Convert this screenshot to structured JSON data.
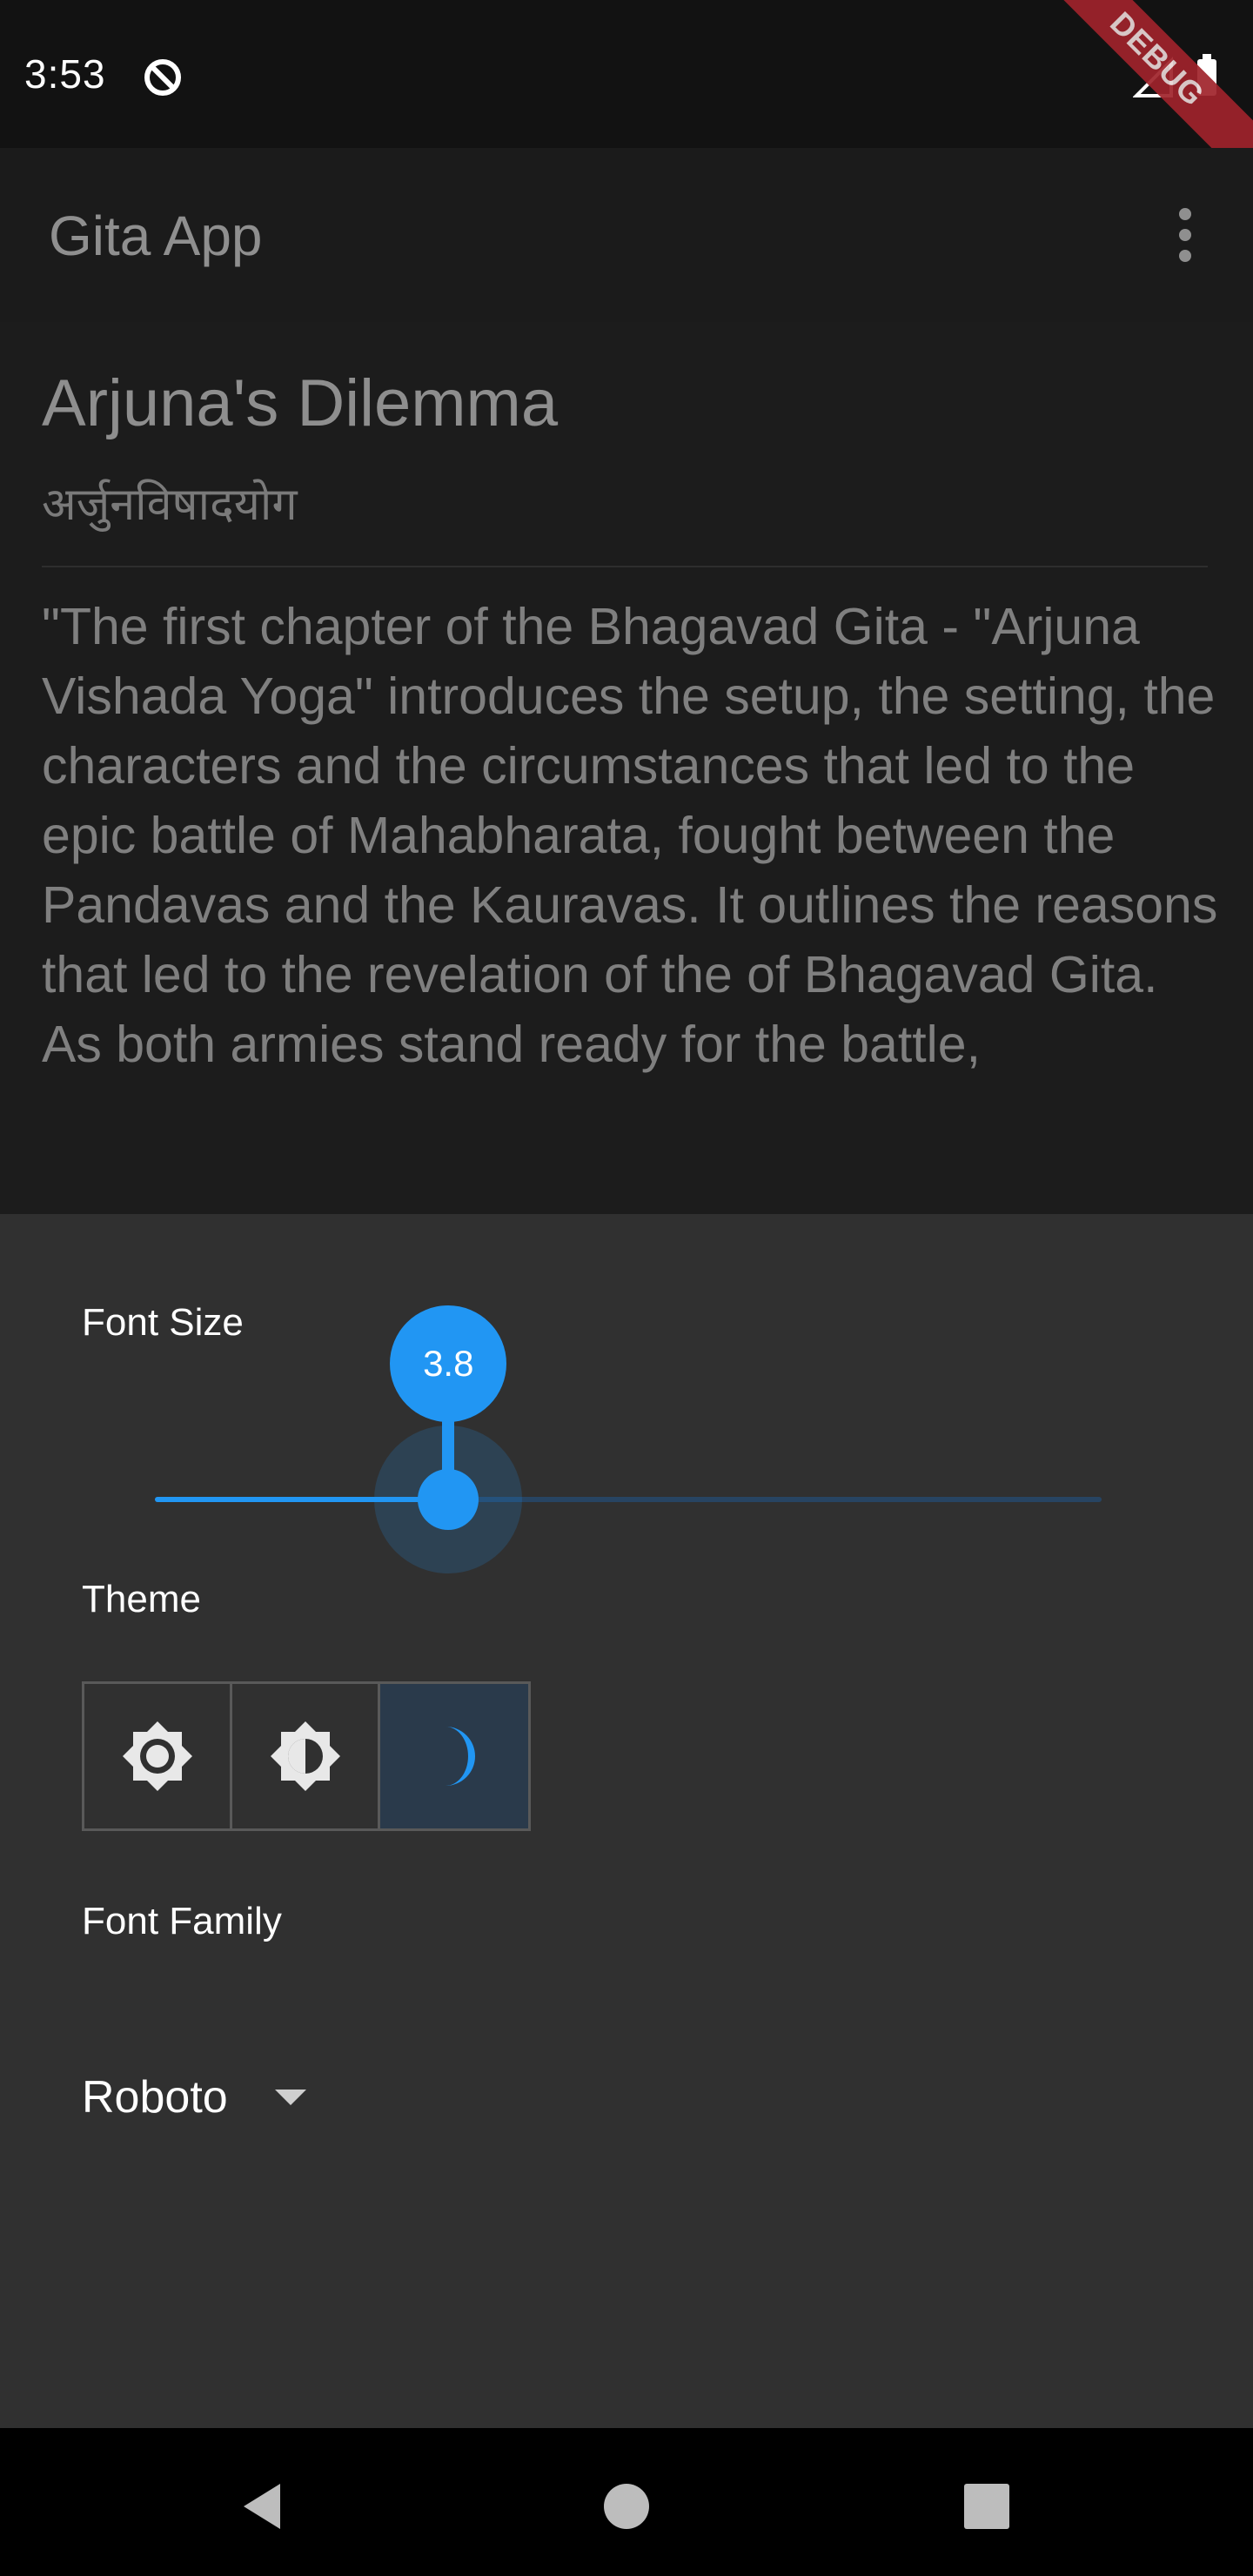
{
  "status_bar": {
    "time": "3:53",
    "debug_banner": "DEBUG",
    "icons": [
      "sync-icon",
      "signal-icon",
      "battery-icon"
    ]
  },
  "app_bar": {
    "title": "Gita App",
    "menu_icon": "more-vert-icon"
  },
  "chapter": {
    "title": "Arjuna's Dilemma",
    "subtitle": "अर्जुनविषादयोग",
    "body": "\"The first chapter of the Bhagavad Gita - \"Arjuna Vishada Yoga\" introduces the setup, the setting, the characters and the circumstances that led to the epic battle of Mahabharata, fought between the Pandavas and the Kauravas. It outlines the reasons that led to the revelation of the of Bhagavad Gita.\nAs both armies stand ready for the battle,"
  },
  "settings_sheet": {
    "font_size_label": "Font Size",
    "font_size_value": "3.8",
    "font_size_fraction": 0.31,
    "theme_label": "Theme",
    "theme_options": [
      {
        "icon": "light-mode-icon",
        "selected": false
      },
      {
        "icon": "auto-brightness-icon",
        "selected": false
      },
      {
        "icon": "dark-mode-icon",
        "selected": true
      }
    ],
    "font_family_label": "Font Family",
    "font_family_value": "Roboto"
  },
  "nav_bar": {
    "icons": [
      "back-icon",
      "home-icon",
      "recents-icon"
    ]
  },
  "colors": {
    "accent": "#2196f3",
    "sheet_background": "#303030",
    "debug_banner": "#a0232b"
  }
}
